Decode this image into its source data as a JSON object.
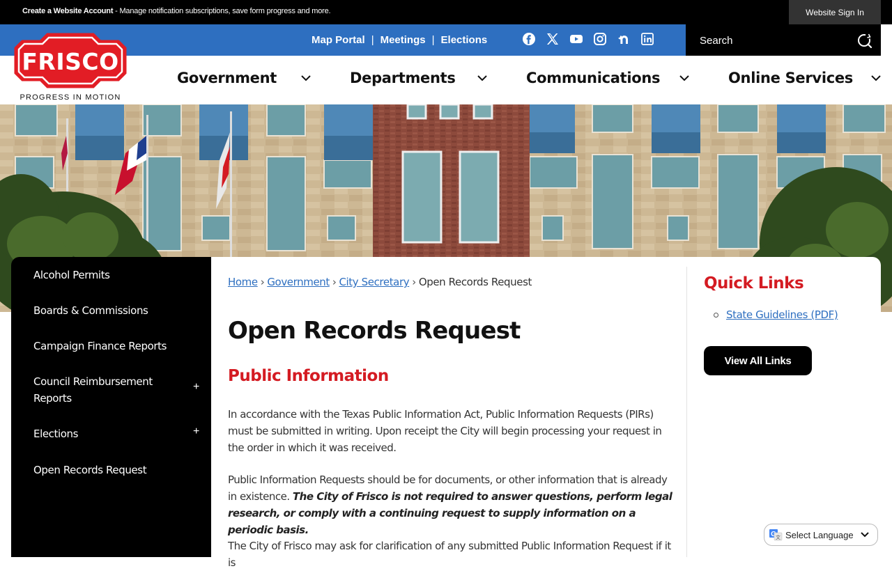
{
  "topbar": {
    "account_label": "Create a Website Account",
    "account_desc": " - Manage notification subscriptions, save form progress and more.",
    "signin_label": "Website Sign In"
  },
  "utility": {
    "links": [
      "Map Portal",
      "Meetings",
      "Elections"
    ],
    "separator": "|",
    "social_icons": [
      "facebook-icon",
      "x-twitter-icon",
      "youtube-icon",
      "instagram-icon",
      "nextdoor-icon",
      "linkedin-icon"
    ]
  },
  "search": {
    "placeholder": "Search"
  },
  "logo": {
    "name": "FRISCO",
    "tagline": "PROGRESS IN MOTION"
  },
  "nav": {
    "items": [
      "Government",
      "Departments",
      "Communications",
      "Online Services"
    ]
  },
  "sidebar": {
    "items": [
      {
        "label": "Alcohol Permits",
        "expandable": false
      },
      {
        "label": "Boards & Commissions",
        "expandable": false
      },
      {
        "label": "Campaign Finance Reports",
        "expandable": false
      },
      {
        "label": "Council Reimbursement Reports",
        "expandable": true
      },
      {
        "label": "Elections",
        "expandable": true
      },
      {
        "label": "Open Records Request",
        "expandable": false
      }
    ],
    "expand_symbol": "+"
  },
  "breadcrumb": {
    "links": [
      "Home",
      "Government",
      "City Secretary"
    ],
    "current": "Open Records Request",
    "separator": "›"
  },
  "main": {
    "title": "Open Records Request",
    "section_title": "Public Information",
    "para1": "In accordance with the Texas Public Information Act, Public Information Requests (PIRs) must be submitted in writing. Upon receipt the City will begin processing your request in the order in which it was received.",
    "para2_start": "Public Information Requests should be for documents, or other information that is already in existence. ",
    "para2_emphasis": "The City of Frisco is not required to answer questions, perform legal research, or comply with a continuing request to supply information on a periodic basis.",
    "para3": "The City of Frisco may ask for clarification of any submitted Public Information Request if it is"
  },
  "quick_links": {
    "title": "Quick Links",
    "items": [
      "State Guidelines (PDF)"
    ],
    "view_all_label": "View All Links"
  },
  "translate": {
    "label": "Select Language"
  },
  "colors": {
    "brand_red": "#d41b22",
    "brand_blue": "#2e6fc0",
    "black": "#000000"
  }
}
